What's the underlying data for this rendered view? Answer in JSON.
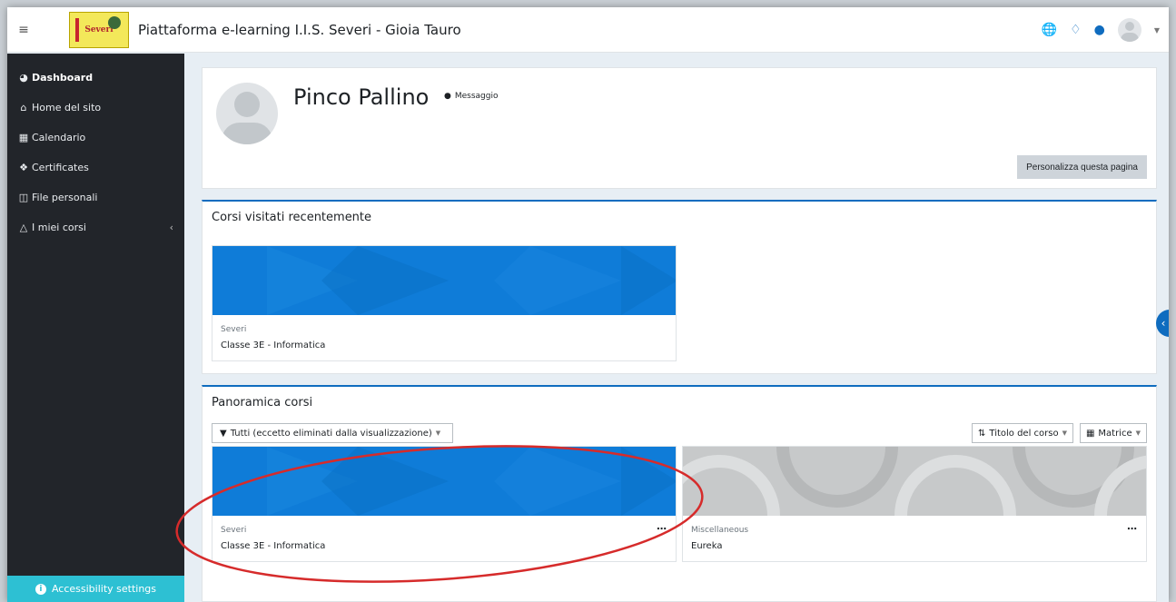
{
  "header": {
    "menu_icon": "hamburger-icon",
    "site_name": "Piattaforma e-learning I.I.S. Severi - Gioia Tauro",
    "logo_text": "Severi",
    "icons": [
      "globe-icon",
      "bell-icon",
      "chat-icon",
      "user-avatar",
      "chevron-down-icon"
    ]
  },
  "sidebar": {
    "items": [
      {
        "label": "Dashboard",
        "icon": "dashboard-icon"
      },
      {
        "label": "Home del sito",
        "icon": "home-icon"
      },
      {
        "label": "Calendario",
        "icon": "calendar-icon"
      },
      {
        "label": "Certificates",
        "icon": "certificate-icon"
      },
      {
        "label": "File personali",
        "icon": "file-icon"
      },
      {
        "label": "I miei corsi",
        "icon": "graduation-cap-icon"
      }
    ],
    "accessibility": "Accessibility settings"
  },
  "profile": {
    "name": "Pinco Pallino",
    "message_link": "Messaggio",
    "customize_button": "Personalizza questa pagina"
  },
  "recent": {
    "title": "Corsi visitati recentemente",
    "courses": [
      {
        "category": "Severi",
        "name": "Classe 3E - Informatica"
      }
    ]
  },
  "overview": {
    "title": "Panoramica corsi",
    "filter": "Tutti (eccetto eliminati dalla visualizzazione)",
    "sort": "Titolo del corso",
    "view": "Matrice",
    "courses": [
      {
        "category": "Severi",
        "name": "Classe 3E - Informatica"
      },
      {
        "category": "Miscellaneous",
        "name": "Eureka"
      }
    ]
  },
  "colors": {
    "accent": "#0f6cbf",
    "sidebar_bg": "#22252a",
    "accessibility_bg": "#2dc0d3",
    "highlight_ellipse": "#d62b2b"
  }
}
